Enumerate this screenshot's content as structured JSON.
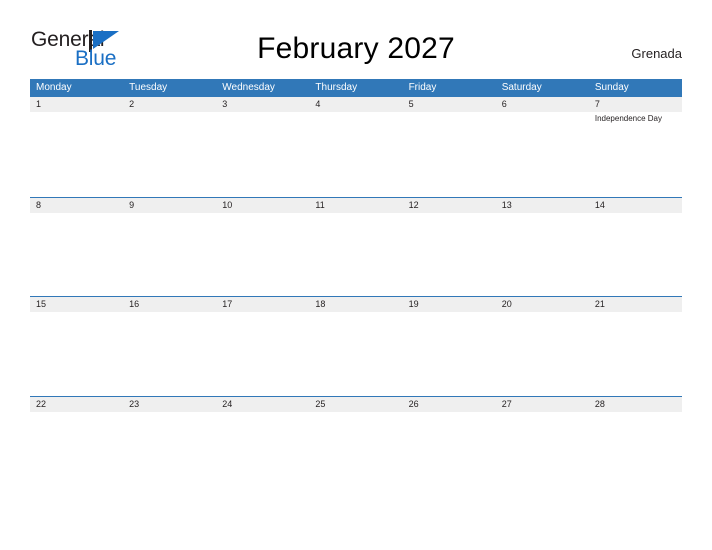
{
  "logo": {
    "word_one": "General",
    "word_two": "Blue",
    "flag_icon": "flag-triangle-icon",
    "word_one_color": "#231f20",
    "word_two_color": "#1a6fc4",
    "flag_color": "#1a6fc4"
  },
  "header": {
    "title": "February 2027",
    "country": "Grenada"
  },
  "theme": {
    "header_blue": "#3178b8",
    "day_band_gray": "#efefef",
    "text_dark": "#231f20",
    "page_background": "#ffffff"
  },
  "calendar": {
    "month": "February",
    "year": "2027",
    "weekday_headers": [
      "Monday",
      "Tuesday",
      "Wednesday",
      "Thursday",
      "Friday",
      "Saturday",
      "Sunday"
    ],
    "weeks": [
      [
        {
          "day": "1",
          "events": []
        },
        {
          "day": "2",
          "events": []
        },
        {
          "day": "3",
          "events": []
        },
        {
          "day": "4",
          "events": []
        },
        {
          "day": "5",
          "events": []
        },
        {
          "day": "6",
          "events": []
        },
        {
          "day": "7",
          "events": [
            "Independence Day"
          ]
        }
      ],
      [
        {
          "day": "8",
          "events": []
        },
        {
          "day": "9",
          "events": []
        },
        {
          "day": "10",
          "events": []
        },
        {
          "day": "11",
          "events": []
        },
        {
          "day": "12",
          "events": []
        },
        {
          "day": "13",
          "events": []
        },
        {
          "day": "14",
          "events": []
        }
      ],
      [
        {
          "day": "15",
          "events": []
        },
        {
          "day": "16",
          "events": []
        },
        {
          "day": "17",
          "events": []
        },
        {
          "day": "18",
          "events": []
        },
        {
          "day": "19",
          "events": []
        },
        {
          "day": "20",
          "events": []
        },
        {
          "day": "21",
          "events": []
        }
      ],
      [
        {
          "day": "22",
          "events": []
        },
        {
          "day": "23",
          "events": []
        },
        {
          "day": "24",
          "events": []
        },
        {
          "day": "25",
          "events": []
        },
        {
          "day": "26",
          "events": []
        },
        {
          "day": "27",
          "events": []
        },
        {
          "day": "28",
          "events": []
        }
      ]
    ]
  }
}
